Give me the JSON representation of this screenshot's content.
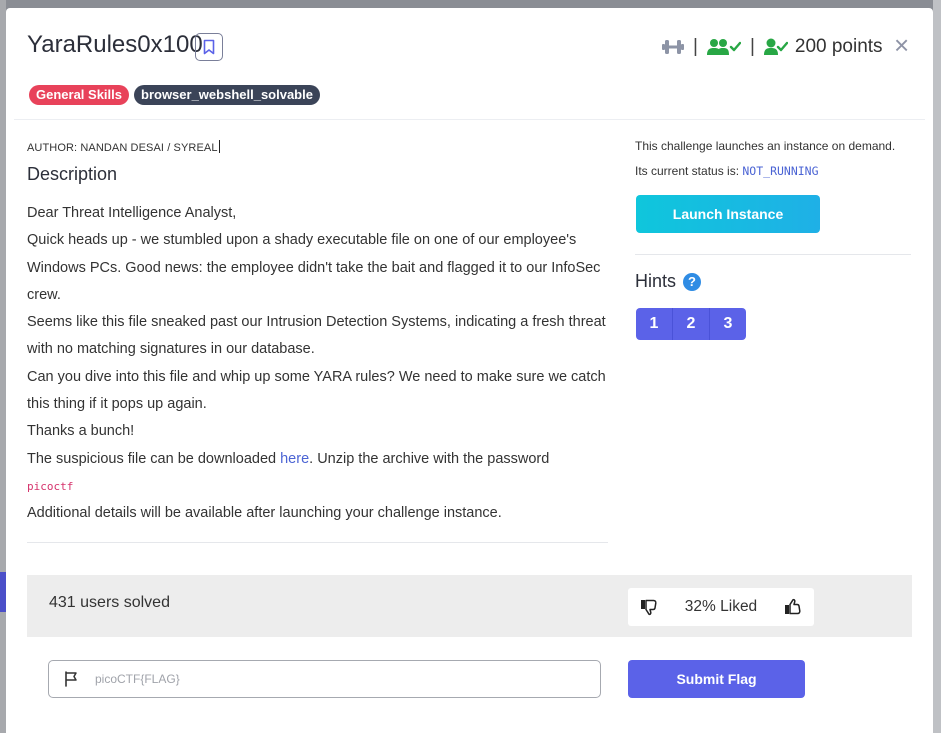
{
  "challenge": {
    "title": "YaraRules0x100",
    "points": "200 points",
    "separator": "|",
    "close": "×"
  },
  "tags": [
    "General Skills",
    "browser_webshell_solvable"
  ],
  "author": "AUTHOR: NANDAN DESAI / SYREAL",
  "description": {
    "heading": "Description",
    "p1": "Dear Threat Intelligence Analyst,",
    "p2": "Quick heads up - we stumbled upon a shady executable file on one of our employee's Windows PCs. Good news: the employee didn't take the bait and flagged it to our InfoSec crew.",
    "p3": "Seems like this file sneaked past our Intrusion Detection Systems, indicating a fresh threat with no matching signatures in our database.",
    "p4": "Can you dive into this file and whip up some YARA rules? We need to make sure we catch this thing if it pops up again.",
    "p5": "Thanks a bunch!",
    "p6_before": "The suspicious file can be downloaded ",
    "p6_link": "here",
    "p6_after": ". Unzip the archive with the password",
    "password": "picoctf",
    "p7": "Additional details will be available after launching your challenge instance."
  },
  "instance": {
    "line1": "This challenge launches an instance on demand.",
    "status_label": "Its current status is: ",
    "status_value": "NOT_RUNNING",
    "launch_label": "Launch Instance"
  },
  "hints": {
    "heading": "Hints",
    "help": "?",
    "items": [
      "1",
      "2",
      "3"
    ]
  },
  "stats": {
    "solved": "431 users solved",
    "liked": "32% Liked"
  },
  "flag": {
    "placeholder": "picoCTF{FLAG}",
    "value": "",
    "submit_label": "Submit Flag"
  },
  "colors": {
    "accent": "#5b62e8",
    "launch": "#0fc6dc",
    "tag_red": "#e8425a",
    "tag_dark": "#3b4458",
    "user_icons": "#28a745"
  },
  "icons": [
    "bookmark-icon",
    "dumbbell-icon",
    "users-check-icon",
    "user-check-icon",
    "close-icon",
    "help-icon",
    "thumbs-down-icon",
    "thumbs-up-icon",
    "flag-icon"
  ]
}
